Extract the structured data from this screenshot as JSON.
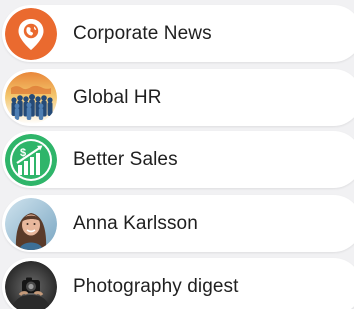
{
  "channels": [
    {
      "name": "Corporate News",
      "icon": "location-pin-globe-icon",
      "color": "#ea6a2f"
    },
    {
      "name": "Global HR",
      "icon": "people-crowd-icon",
      "color": "#2f5a86"
    },
    {
      "name": "Better Sales",
      "icon": "dollar-growth-chart-icon",
      "color": "#2fb56a"
    },
    {
      "name": "Anna Karlsson",
      "icon": "person-photo-icon",
      "color": "#8fb7d0"
    },
    {
      "name": "Photography digest",
      "icon": "camera-photo-icon",
      "color": "#3a3a3a"
    }
  ]
}
